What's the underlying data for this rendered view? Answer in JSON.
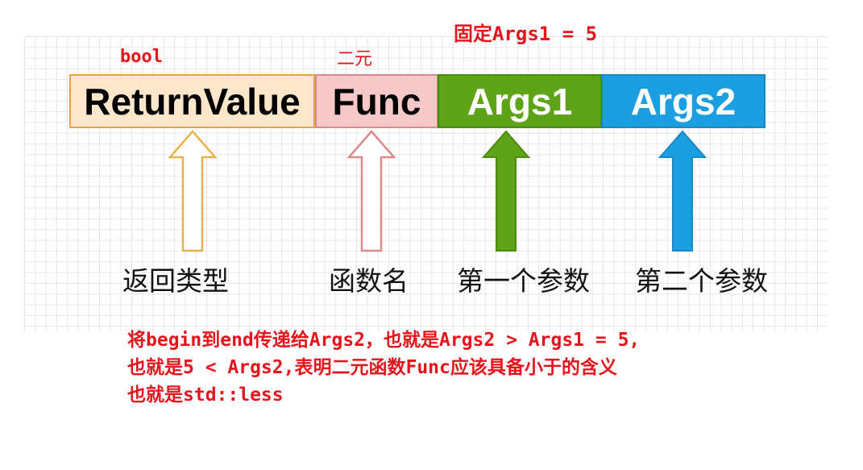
{
  "annotations": {
    "return_type": "bool",
    "func_kind": "二元",
    "fixed_arg": "固定Args1 = 5"
  },
  "boxes": {
    "return_value": "ReturnValue",
    "func": "Func",
    "args1": "Args1",
    "args2": "Args2"
  },
  "labels": {
    "return_type": "返回类型",
    "func_name": "函数名",
    "first_param": "第一个参数",
    "second_param": "第二个参数"
  },
  "note": {
    "line1": "将begin到end传递给Args2，也就是Args2 > Args1 = 5,",
    "line2": "也就是5 < Args2,表明二元函数Func应该具备小于的含义",
    "line3": "也就是std::less"
  },
  "colors": {
    "return_fill": "#fde6c9",
    "return_stroke": "#e3a24f",
    "func_fill": "#f6c9c8",
    "func_stroke": "#d98b8a",
    "args1_fill": "#5fa319",
    "args2_fill": "#1b9fe0",
    "annotation": "#e5141c"
  }
}
